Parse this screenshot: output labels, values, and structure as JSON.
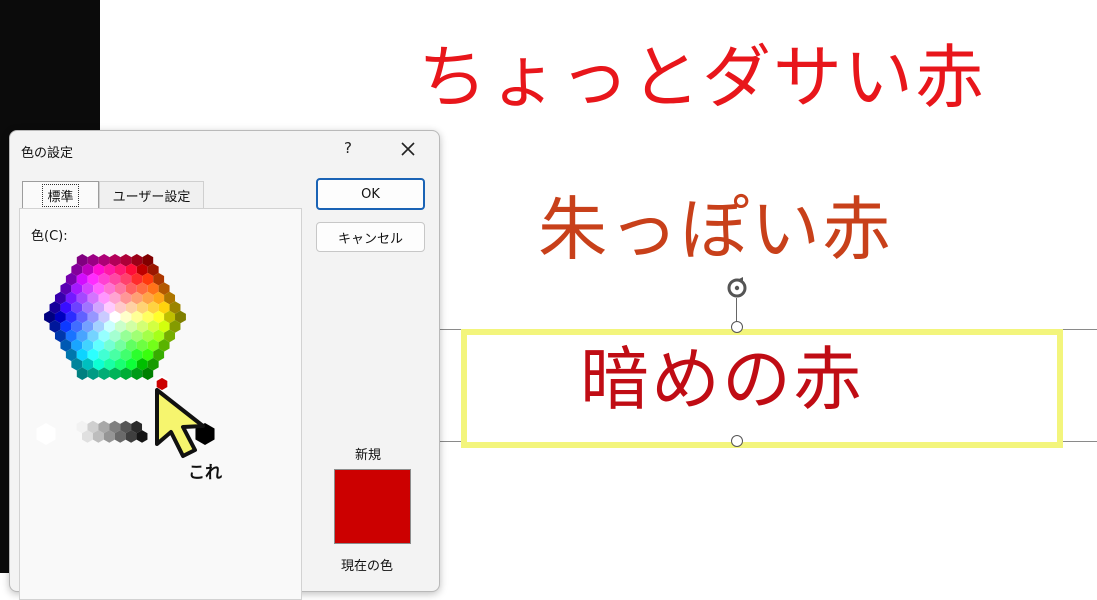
{
  "slide": {
    "line1": "ちょっとダサい赤",
    "line2": "朱っぽい赤",
    "line3": "暗めの赤",
    "colors": {
      "line1": "#e8161b",
      "line2": "#c8401a",
      "line3": "#c00c14",
      "selection_highlight": "#f3f57c"
    }
  },
  "dialog": {
    "title": "色の設定",
    "help": "?",
    "close_icon": "close-icon",
    "tabs": [
      "標準",
      "ユーザー設定"
    ],
    "active_tab": "標準",
    "colors_label": "色(C):",
    "ok_label": "OK",
    "cancel_label": "キャンセル",
    "new_label": "新規",
    "current_label": "現在の色",
    "new_color": "#cc0000"
  },
  "annotation": {
    "callout": "これ",
    "cursor_icon": "pointer-cursor-icon"
  }
}
